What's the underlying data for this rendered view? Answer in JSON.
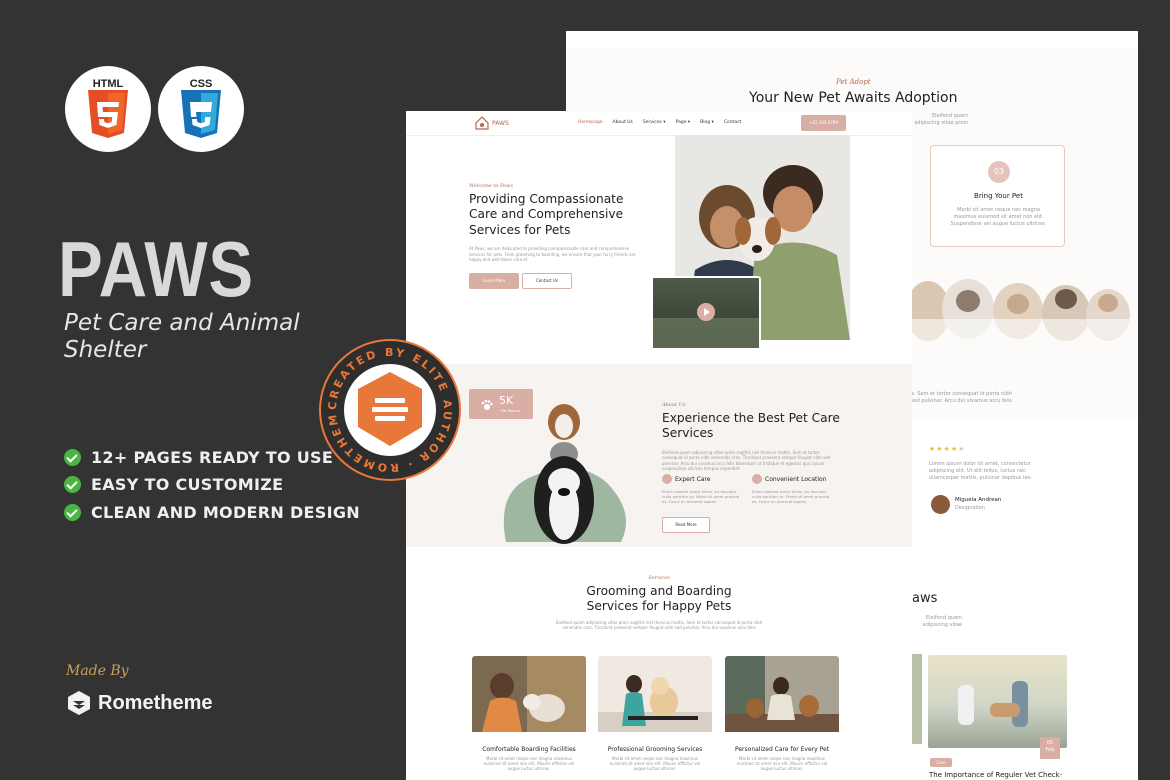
{
  "badges": {
    "html": "HTML",
    "css": "CSS"
  },
  "brand": {
    "title": "PAWS",
    "subtitle": "Pet Care and Animal Shelter"
  },
  "features": [
    "12+ PAGES READY TO USE",
    "EASY TO CUSTOMIZE",
    "CLEAN AND MODERN DESIGN"
  ],
  "seal": {
    "text": "CREATED BY ELITE AUTHOR · ROMETHEME STD ·"
  },
  "maker": {
    "made_by": "Made By",
    "name": "Rometheme"
  },
  "back_page": {
    "tag": "Pet Adopt",
    "title": "Your New Pet Awaits Adoption",
    "intro": "Eleifend quam adipiscing vitae proin sagittis nisl rhoncus mattis. Sem et tortor consequat id porta nibh venenatis cras. Tincidunt praesent semper feugiat nibh sed pulvinar. Arcu dui vivamus arcu felis",
    "card": {
      "number": "03",
      "title": "Bring Your Pet",
      "text": "Morbi sit amet neque nec magna maximus euismod sit amet non elit. Suspendisse vel augue luctus ultrices."
    },
    "testimonial": {
      "text_a": "Eleifend quam adipiscing vitae proin sagittis nisl rhoncus mattis. Sem et tortor consequat id porta nibh",
      "text_b": "venenatis cras. Tincidunt praesent semper feugiat nibh sed pulvinar. Arcu dui vivamus arcu felis",
      "quote": "Lorem ipsum dolor sit amet, consectetur adipiscing elit. Ut elit tellus, luctus nec ullamcorper mattis, pulvinar dapibus leo.",
      "name": "Miguela Andrean",
      "role": "Designation",
      "rating": 4
    },
    "blog_title_fragment": "aws",
    "blog_card": {
      "category": "Care",
      "day": "05",
      "month": "Feb",
      "title": "The Importance of Reguler Vet Check-"
    }
  },
  "front_page": {
    "nav": {
      "logo": "PAWS",
      "items": [
        "Homepage",
        "About Us",
        "Services ▾",
        "Page ▾",
        "Blog ▾",
        "Contact"
      ],
      "cta": "+62 345 6789"
    },
    "hero": {
      "tag": "Welcome to Paws",
      "title": "Providing Compassionate Care and Comprehensive Services for Pets",
      "text": "At Paws, we are dedicated to providing compassionate care and comprehensive services for pets. From grooming to boarding, we ensure that your furry friends are happy and well-taken care of.",
      "btn_primary": "Learn More",
      "btn_secondary": "Contact Us"
    },
    "about": {
      "stat_value": "5K",
      "stat_label": "Pet Rescue",
      "tag": "About Us",
      "title": "Experience the Best Pet Care Services",
      "text": "Eleifend quam adipiscing vitae proin sagittis nisl rhoncus mattis. Sem et tortor consequat id porta nibh venenatis cras. Tincidunt praesent semper feugiat nibh sed pulvinar. Arcu dui vivamus arcu felis bibendum ut tristique et egestas quis ipsum suspendisse ultrices tempus imperdiet.",
      "feature1": {
        "title": "Expert Care",
        "text": "Etiam lobortis turpis tellus, eu faucibus nulla porttitor ac. Morbi sit amet gravida ex. Fusce eu placerat sapien."
      },
      "feature2": {
        "title": "Convenient Location",
        "text": "Etiam lobortis turpis tellus, eu faucibus nulla porttitor ac. Morbi sit amet gravida ex. Fusce eu placerat sapien."
      },
      "button": "Read More"
    },
    "services": {
      "tag": "Services",
      "title": "Grooming and Boarding Services for Happy Pets",
      "text": "Eleifend quam adipiscing vitae proin sagittis nisl rhoncus mattis. Sem et tortor consequat id porta nibh venenatis cras. Tincidunt praesent semper feugiat nibh sed pulvinar. Arcu dui vivamus arcu felis",
      "cards": [
        {
          "title": "Comfortable Boarding Facilities",
          "text": "Morbi sit amet neque nec magna maximus euismod sit amet non elit. Mauris efficitur vel augue luctus ultrices."
        },
        {
          "title": "Professional Grooming Services",
          "text": "Morbi sit amet neque nec magna maximus euismod sit amet non elit. Mauris efficitur vel augue luctus ultrices."
        },
        {
          "title": "Personalized Care for Every Pet",
          "text": "Morbi sit amet neque nec magna maximus euismod sit amet non elit. Mauris efficitur vel augue luctus ultrices."
        }
      ]
    }
  },
  "colors": {
    "background": "#333333",
    "accent": "#d9aea5",
    "brand_brown": "#b06a52",
    "seal_orange": "#e8773a",
    "check_green": "#4bb543"
  }
}
